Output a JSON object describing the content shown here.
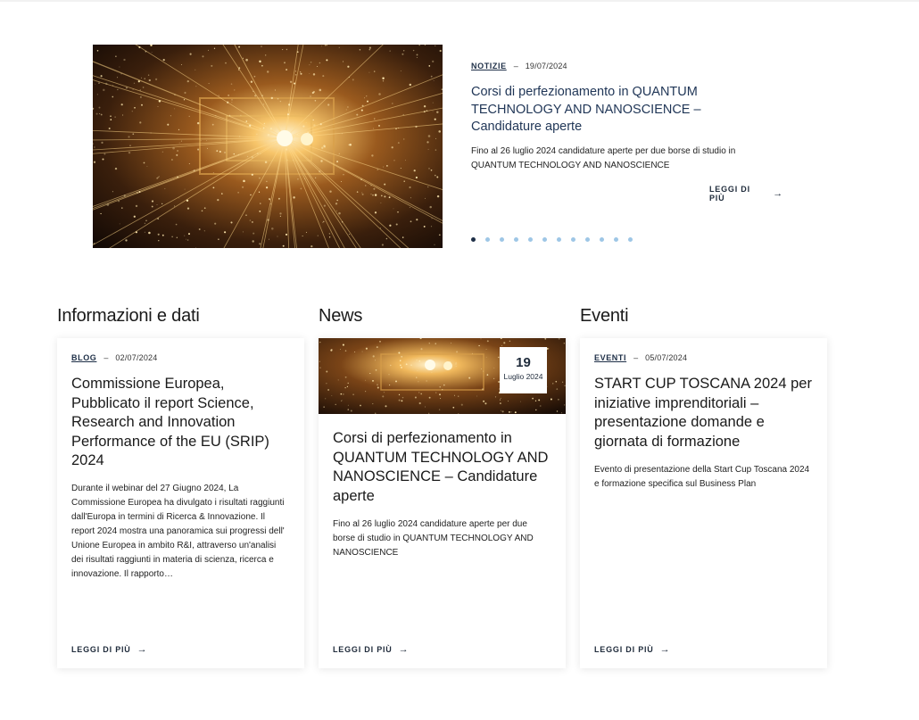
{
  "hero": {
    "category": "NOTIZIE",
    "date": "19/07/2024",
    "title": "Corsi di perfezionamento in QUANTUM TECHNOLOGY AND NANOSCIENCE – Candidature aperte",
    "description": "Fino al 26 luglio 2024 candidature aperte per due borse di studio in QUANTUM TECHNOLOGY AND NANOSCIENCE",
    "more_label": "LEGGI DI PIÙ",
    "arrow": "→",
    "dash": "–",
    "dots_count": 12,
    "active_dot": 1,
    "image_icon": "light-tunnel-image"
  },
  "sections": {
    "info": {
      "title": "Informazioni e dati",
      "card": {
        "category": "BLOG",
        "date": "02/07/2024",
        "title": "Commissione Europea, Pubblicato il report Science, Research and Innovation Performance of the EU (SRIP) 2024",
        "description": "Durante il webinar del 27 Giugno 2024, La Commissione Europea ha divulgato i risultati raggiunti dall'Europa in termini di Ricerca & Innovazione. Il report 2024 mostra una panoramica sui progressi dell' Unione Europea in ambito R&I, attraverso un'analisi dei risultati raggiunti in materia di scienza, ricerca e innovazione. Il rapporto…",
        "more_label": "LEGGI DI PIÙ"
      }
    },
    "news": {
      "title": "News",
      "card": {
        "day": "19",
        "month_year": "Luglio 2024",
        "title": "Corsi di perfezionamento in QUANTUM TECHNOLOGY AND NANOSCIENCE – Candidature aperte",
        "description": "Fino al 26 luglio 2024 candidature aperte per due borse di studio in QUANTUM TECHNOLOGY AND NANOSCIENCE",
        "more_label": "LEGGI DI PIÙ"
      }
    },
    "events": {
      "title": "Eventi",
      "card": {
        "category": "EVENTI",
        "date": "05/07/2024",
        "title": "START CUP TOSCANA 2024 per iniziative imprenditoriali – presentazione domande e giornata di formazione",
        "description": "Evento di presentazione della Start Cup Toscana 2024 e formazione specifica sul Business Plan",
        "more_label": "LEGGI DI PIÙ"
      }
    }
  },
  "colors": {
    "dark_blue": "#1e2f47",
    "title_blue": "#1f3556",
    "dot_inactive": "#9ec6e6"
  }
}
